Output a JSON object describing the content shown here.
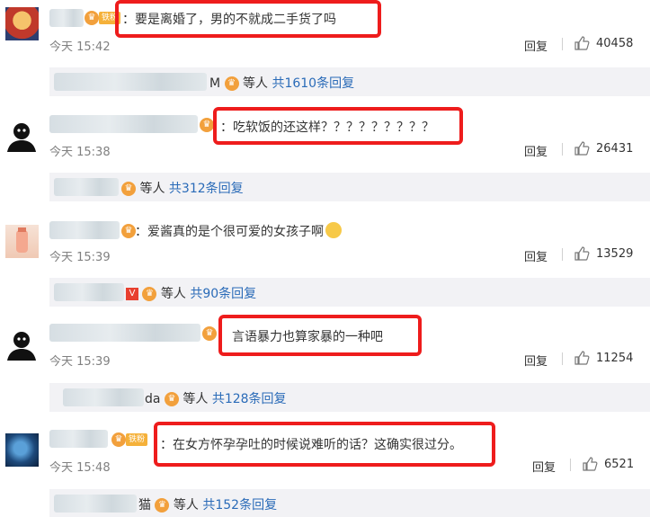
{
  "comments": [
    {
      "text": "：要是离婚了，男的不就成二手货了吗",
      "time": "今天 15:42",
      "reply": "回复",
      "likes": "40458",
      "badge": "铁粉"
    },
    {
      "text": "：吃软饭的还这样？？？？？？？？？",
      "time": "今天 15:38",
      "reply": "回复",
      "likes": "26431"
    },
    {
      "text": "：爱酱真的是个很可爱的女孩子啊",
      "time": "今天 15:39",
      "reply": "回复",
      "likes": "13529"
    },
    {
      "text": "言语暴力也算家暴的一种吧",
      "time": "今天 15:39",
      "reply": "回复",
      "likes": "11254"
    },
    {
      "text": "：在女方怀孕孕吐的时候说难听的话？这确实很过分。",
      "time": "今天 15:48",
      "reply": "回复",
      "likes": "6521",
      "badge": "铁粉"
    }
  ],
  "subreplies": [
    {
      "prefix_tail": "M",
      "tail": "等人",
      "link": "共1610条回复"
    },
    {
      "prefix_tail": "",
      "tail": "等人",
      "link": "共312条回复"
    },
    {
      "prefix_tail": "",
      "tail": "等人",
      "link": "共90条回复"
    },
    {
      "prefix_tail": "da",
      "tail": "等人",
      "link": "共128条回复"
    },
    {
      "prefix_tail": "猫",
      "tail": "等人",
      "link": "共152条回复"
    }
  ],
  "icons": {
    "like": "thumbs-up-icon",
    "vip": "crown-badge-icon",
    "emoji": "pleading-face-icon"
  },
  "colors": {
    "highlight": "#ee1c1c",
    "link": "#2a6bb8",
    "subbar": "#f2f2f5",
    "badge": "#f2a03c"
  }
}
